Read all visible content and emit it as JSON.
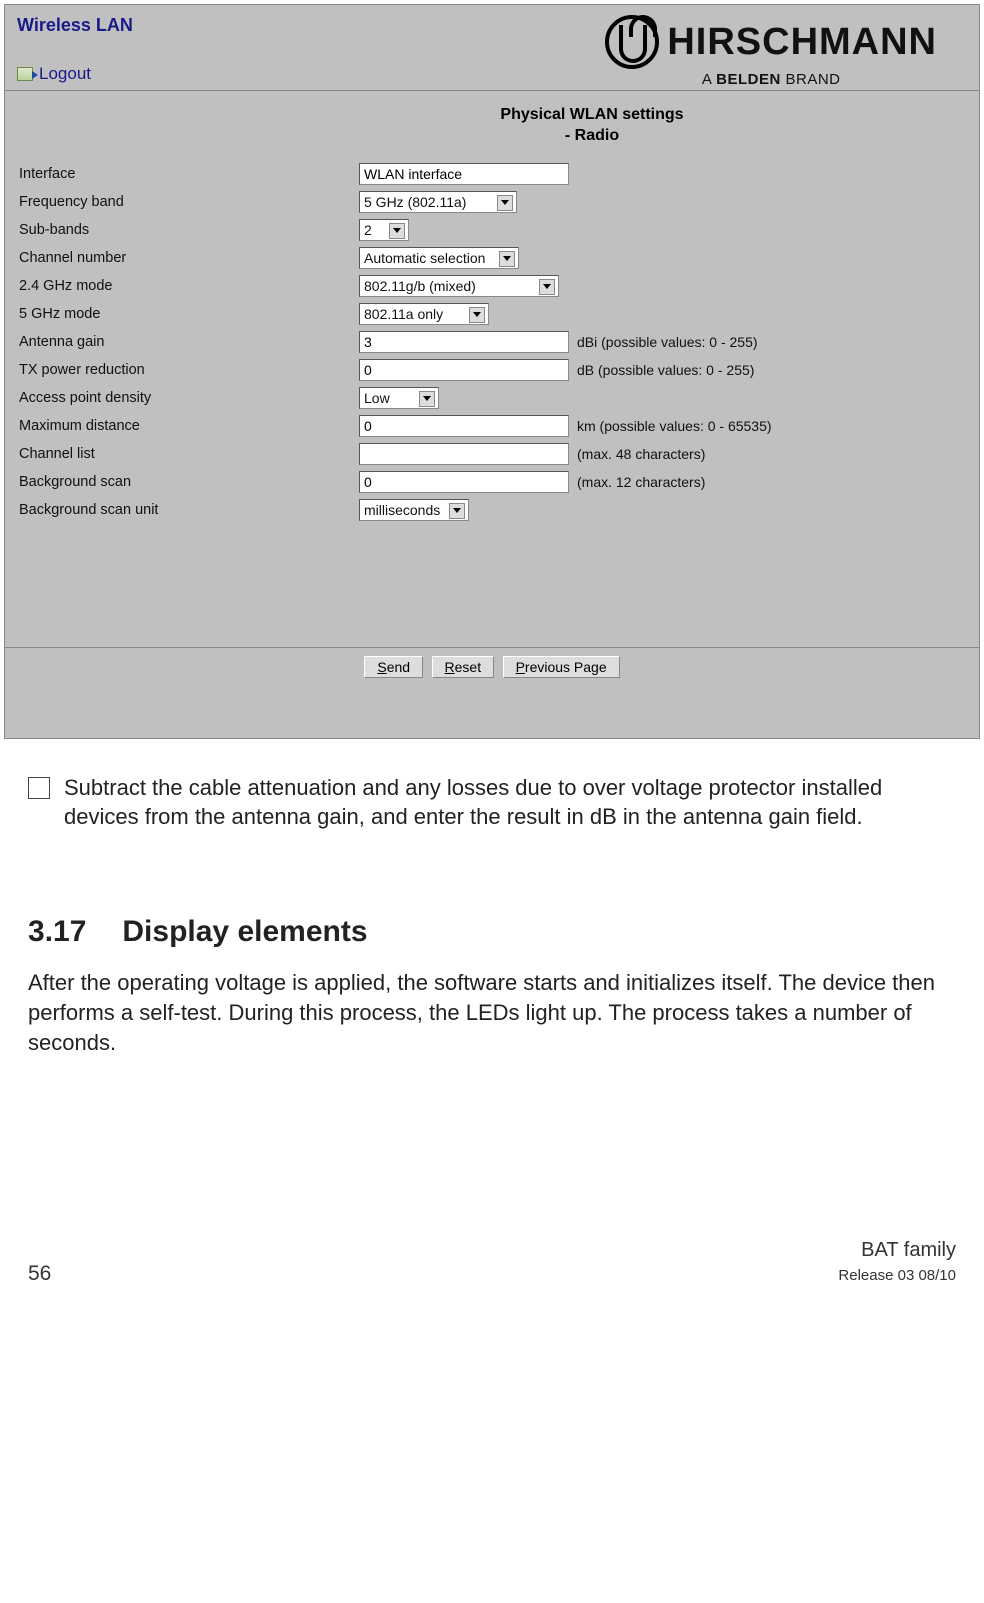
{
  "header": {
    "wireless_lan": "Wireless LAN",
    "logout": "Logout",
    "brand_name": "HIRSCHMANN",
    "brand_sub_a": "A ",
    "brand_sub_b": "BELDEN",
    "brand_sub_c": " BRAND"
  },
  "form": {
    "title_line1": "Physical WLAN settings",
    "title_line2": "- Radio",
    "rows": {
      "interface": {
        "label": "Interface",
        "value": "WLAN interface"
      },
      "freq_band": {
        "label": "Frequency band",
        "value": "5 GHz (802.11a)"
      },
      "sub_bands": {
        "label": "Sub-bands",
        "value": "2"
      },
      "channel_number": {
        "label": "Channel number",
        "value": "Automatic selection"
      },
      "mode_24": {
        "label": "2.4 GHz mode",
        "value": "802.11g/b (mixed)"
      },
      "mode_5": {
        "label": "5 GHz mode",
        "value": "802.11a only"
      },
      "antenna_gain": {
        "label": "Antenna gain",
        "value": "3",
        "hint": "dBi (possible values: 0 - 255)"
      },
      "tx_power": {
        "label": "TX power reduction",
        "value": "0",
        "hint": "dB (possible values: 0 - 255)"
      },
      "ap_density": {
        "label": "Access point density",
        "value": "Low"
      },
      "max_distance": {
        "label": "Maximum distance",
        "value": "0",
        "hint": "km (possible values: 0 - 65535)"
      },
      "channel_list": {
        "label": "Channel list",
        "value": "",
        "hint": "(max. 48 characters)"
      },
      "bg_scan": {
        "label": "Background scan",
        "value": "0",
        "hint": "(max. 12 characters)"
      },
      "bg_scan_unit": {
        "label": "Background scan unit",
        "value": "milliseconds"
      }
    },
    "buttons": {
      "send": "Send",
      "reset": "Reset",
      "prev": "Previous Page"
    }
  },
  "doc": {
    "checkbox_text": "Subtract the cable attenuation and any losses due to over voltage protector installed devices from the antenna gain, and enter the result in dB in the antenna gain field.",
    "section_num": "3.17",
    "section_title": "Display elements",
    "section_body": "After the operating voltage is applied, the software starts and initializes itself. The device then performs a self-test. During this process, the LEDs light up. The process takes a number of seconds."
  },
  "footer": {
    "page": "56",
    "family": "BAT family",
    "release": "Release  03  08/10"
  }
}
